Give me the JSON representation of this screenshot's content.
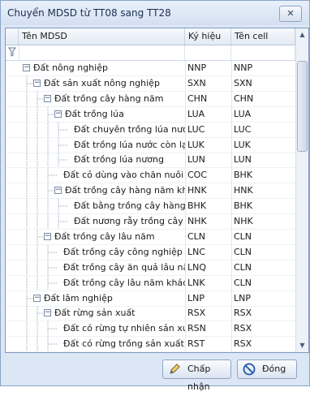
{
  "window": {
    "title": "Chuyển MDSD từ TT08 sang TT28",
    "close_label": "✕"
  },
  "columns": {
    "name": "Tên MDSD",
    "symbol": "Ký hiệu",
    "cell": "Tên cell"
  },
  "rows": [
    {
      "name": "Đất nông nghiệp",
      "symbol": "NNP",
      "cell": "NNP",
      "level": 0,
      "toggle": "−"
    },
    {
      "name": "Đất sản xuất nông nghiệp",
      "symbol": "SXN",
      "cell": "SXN",
      "level": 1,
      "toggle": "−"
    },
    {
      "name": "Đất trồng cây hàng năm",
      "symbol": "CHN",
      "cell": "CHN",
      "level": 2,
      "toggle": "−"
    },
    {
      "name": "Đất trồng lúa",
      "symbol": "LUA",
      "cell": "LUA",
      "level": 3,
      "toggle": "−"
    },
    {
      "name": "Đất chuyên trồng lúa nước",
      "symbol": "LUC",
      "cell": "LUC",
      "level": 4,
      "toggle": ""
    },
    {
      "name": "Đất trồng lúa nước còn lại",
      "symbol": "LUK",
      "cell": "LUK",
      "level": 4,
      "toggle": ""
    },
    {
      "name": "Đất trồng lúa nương",
      "symbol": "LUN",
      "cell": "LUN",
      "level": 4,
      "toggle": ""
    },
    {
      "name": "Đất cỏ dùng vào chăn nuôi",
      "symbol": "COC",
      "cell": "BHK",
      "level": 3,
      "toggle": ""
    },
    {
      "name": "Đất trồng cây hàng năm khác",
      "symbol": "HNK",
      "cell": "HNK",
      "level": 3,
      "toggle": "−"
    },
    {
      "name": "Đất bằng trồng cây hàng ...",
      "symbol": "BHK",
      "cell": "BHK",
      "level": 4,
      "toggle": ""
    },
    {
      "name": "Đất nương rẫy trồng cây ...",
      "symbol": "NHK",
      "cell": "NHK",
      "level": 4,
      "toggle": ""
    },
    {
      "name": "Đất trồng cây lâu năm",
      "symbol": "CLN",
      "cell": "CLN",
      "level": 2,
      "toggle": "−"
    },
    {
      "name": "Đất trồng cây công nghiệp l...",
      "symbol": "LNC",
      "cell": "CLN",
      "level": 3,
      "toggle": ""
    },
    {
      "name": "Đất trồng cây ăn quả lâu năm",
      "symbol": "LNQ",
      "cell": "CLN",
      "level": 3,
      "toggle": ""
    },
    {
      "name": "Đất trồng cây lâu năm khác",
      "symbol": "LNK",
      "cell": "CLN",
      "level": 3,
      "toggle": ""
    },
    {
      "name": "Đất lâm nghiệp",
      "symbol": "LNP",
      "cell": "LNP",
      "level": 1,
      "toggle": "−"
    },
    {
      "name": "Đất rừng sản xuất",
      "symbol": "RSX",
      "cell": "RSX",
      "level": 2,
      "toggle": "−"
    },
    {
      "name": "Đất có rừng tự nhiên sản xuất",
      "symbol": "RSN",
      "cell": "RSX",
      "level": 3,
      "toggle": ""
    },
    {
      "name": "Đất có rừng trồng sản xuất",
      "symbol": "RST",
      "cell": "RSX",
      "level": 3,
      "toggle": ""
    }
  ],
  "buttons": {
    "accept": "Chấp nhận",
    "close": "Đóng"
  },
  "icons": {
    "filter": "filter-icon",
    "accept": "pencil-icon",
    "close": "no-entry-icon"
  },
  "colors": {
    "title_bar": "#d3e0f2",
    "border": "#7f99c0",
    "button_icon_red": "#c22a2a",
    "button_icon_blue": "#2f63b0"
  }
}
